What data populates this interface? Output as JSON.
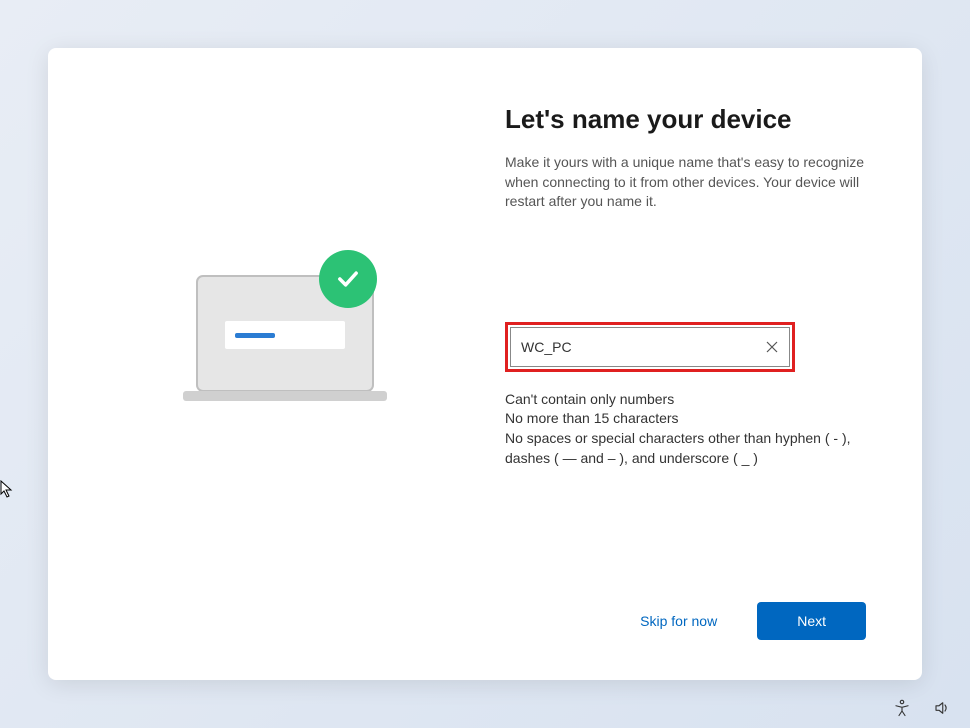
{
  "heading": "Let's name your device",
  "subtitle": "Make it yours with a unique name that's easy to recognize when connecting to it from other devices. Your device will restart after you name it.",
  "input": {
    "value": "WC_PC"
  },
  "hints": {
    "line1": "Can't contain only numbers",
    "line2": "No more than 15 characters",
    "line3": "No spaces or special characters other than hyphen ( - ), dashes ( — and – ), and underscore ( _ )"
  },
  "buttons": {
    "skip": "Skip for now",
    "next": "Next"
  }
}
